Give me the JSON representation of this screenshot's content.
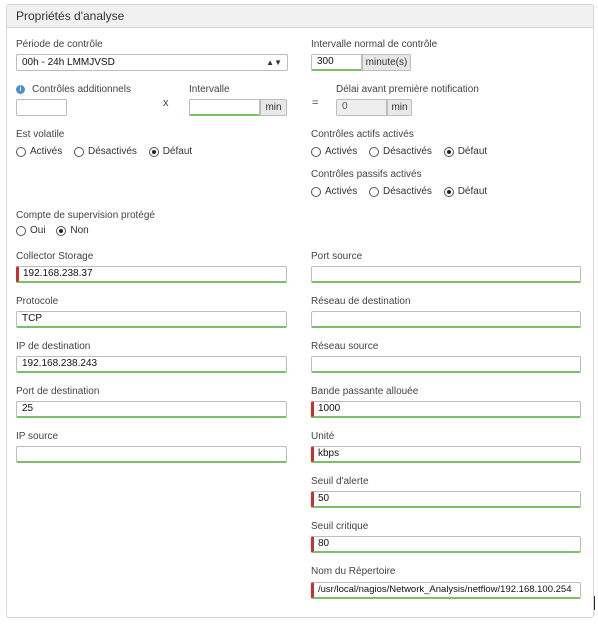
{
  "panel": {
    "title": "Propriétés d'analyse"
  },
  "left": {
    "periode": {
      "label": "Période de contrôle",
      "value": "00h - 24h LMMJVSD"
    },
    "controles_add": {
      "label": "Contrôles additionnels",
      "value": ""
    },
    "times_symbol": "x",
    "intervalle": {
      "label": "Intervalle",
      "value": "",
      "unit": "min"
    },
    "est_volatile": {
      "label": "Est volatile",
      "options": [
        "Activés",
        "Désactivés",
        "Défaut"
      ]
    },
    "compte": {
      "label": "Compte de supervision protégé",
      "options": [
        "Oui",
        "Non"
      ]
    },
    "collector": {
      "label": "Collector Storage",
      "value": "192.168.238.37"
    },
    "protocole": {
      "label": "Protocole",
      "value": "TCP"
    },
    "ip_dest": {
      "label": "IP de destination",
      "value": "192.168.238.243"
    },
    "port_dest": {
      "label": "Port de destination",
      "value": "25"
    },
    "ip_source": {
      "label": "IP source",
      "value": ""
    }
  },
  "right": {
    "intervalle_normal": {
      "label": "Intervalle normal de contrôle",
      "value": "300",
      "unit": "minute(s)"
    },
    "equals_symbol": "=",
    "delai": {
      "label": "Délai avant première notification",
      "value": "0",
      "unit": "min"
    },
    "actifs": {
      "label": "Contrôles actifs activés",
      "options": [
        "Activés",
        "Désactivés",
        "Défaut"
      ]
    },
    "passifs": {
      "label": "Contrôles passifs activés",
      "options": [
        "Activés",
        "Désactivés",
        "Défaut"
      ]
    },
    "port_source": {
      "label": "Port source",
      "value": ""
    },
    "reseau_dest": {
      "label": "Réseau de destination",
      "value": ""
    },
    "reseau_source": {
      "label": "Réseau source",
      "value": ""
    },
    "bande": {
      "label": "Bande passante allouée",
      "value": "1000"
    },
    "unite": {
      "label": "Unité",
      "value": "kbps"
    },
    "seuil_alerte": {
      "label": "Seuil d'alerte",
      "value": "50"
    },
    "seuil_critique": {
      "label": "Seuil critique",
      "value": "80"
    },
    "repertoire": {
      "label": "Nom du Répertoire",
      "value": "/usr/local/nagios/Network_Analysis/netflow/192.168.100.254"
    }
  },
  "selected": {
    "est_volatile": "Défaut",
    "actifs": "Défaut",
    "passifs": "Défaut",
    "compte": "Non"
  },
  "colors": {
    "required_marker": "#c9302c",
    "valid_border": "#7cbf6b",
    "info": "#4a90c8"
  }
}
